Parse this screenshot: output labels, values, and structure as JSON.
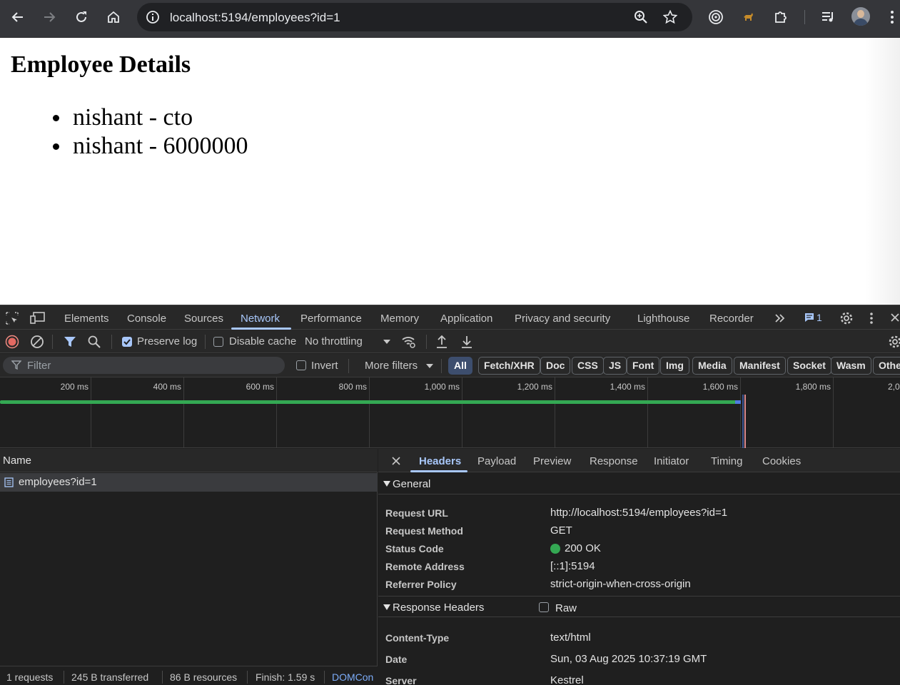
{
  "browser": {
    "url": "localhost:5194/employees?id=1"
  },
  "page": {
    "heading": "Employee Details",
    "items": [
      "nishant - cto",
      "nishant - 6000000"
    ]
  },
  "devtools": {
    "tabs": [
      "Elements",
      "Console",
      "Sources",
      "Network",
      "Performance",
      "Memory",
      "Application",
      "Privacy and security",
      "Lighthouse",
      "Recorder"
    ],
    "active_tab": "Network",
    "issues_count": "1",
    "toolbar": {
      "preserve_log": "Preserve log",
      "disable_cache": "Disable cache",
      "throttling": "No throttling"
    },
    "filter_bar": {
      "filter_placeholder": "Filter",
      "invert": "Invert",
      "more_filters": "More filters",
      "chips": [
        "All",
        "Fetch/XHR",
        "Doc",
        "CSS",
        "JS",
        "Font",
        "Img",
        "Media",
        "Manifest",
        "Socket",
        "Wasm",
        "Other"
      ]
    },
    "timeline": {
      "ticks": [
        "200 ms",
        "400 ms",
        "600 ms",
        "800 ms",
        "1,000 ms",
        "1,200 ms",
        "1,400 ms",
        "1,600 ms",
        "1,800 ms",
        "2,0"
      ]
    },
    "requests": {
      "column_name": "Name",
      "rows": [
        "employees?id=1"
      ],
      "summary": [
        "1 requests",
        "245 B transferred",
        "86 B resources",
        "Finish: 1.59 s",
        "DOMCon"
      ]
    },
    "detail": {
      "tabs": [
        "Headers",
        "Payload",
        "Preview",
        "Response",
        "Initiator",
        "Timing",
        "Cookies"
      ],
      "general_title": "General",
      "general": [
        {
          "key": "Request URL",
          "value": "http://localhost:5194/employees?id=1"
        },
        {
          "key": "Request Method",
          "value": "GET"
        },
        {
          "key": "Status Code",
          "value": "200 OK"
        },
        {
          "key": "Remote Address",
          "value": "[::1]:5194"
        },
        {
          "key": "Referrer Policy",
          "value": "strict-origin-when-cross-origin"
        }
      ],
      "response_title": "Response Headers",
      "raw_label": "Raw",
      "response": [
        {
          "key": "Content-Type",
          "value": "text/html"
        },
        {
          "key": "Date",
          "value": "Sun, 03 Aug 2025 10:37:19 GMT"
        },
        {
          "key": "Server",
          "value": "Kestrel"
        }
      ]
    }
  }
}
